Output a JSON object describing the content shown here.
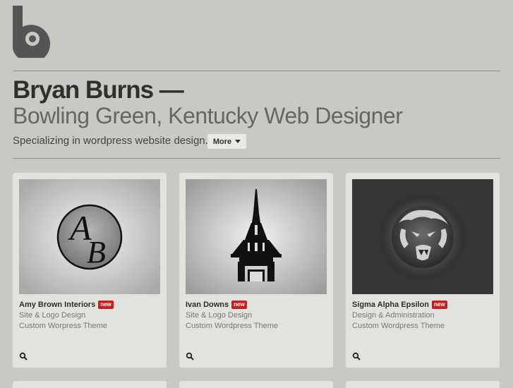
{
  "header": {
    "name": "Bryan Burns —",
    "subtitle": "Bowling Green, Kentucky Web Designer",
    "tagline": "Specializing in wordpress website design.",
    "more_label": "More"
  },
  "portfolio": [
    {
      "title": "Amy Brown Interiors",
      "badge": "new",
      "line1": "Site & Logo Design",
      "line2": "Custom Worpress Theme",
      "thumb_icon": "ab-monogram-logo"
    },
    {
      "title": "Ivan Downs",
      "badge": "new",
      "line1": "Site & Logo Design",
      "line2": "Custom Wordpress Theme",
      "thumb_icon": "tower-spire-logo"
    },
    {
      "title": "Sigma Alpha Epsilon",
      "badge": "new",
      "line1": "Design & Administration",
      "line2": "Custom Wordpress Theme",
      "thumb_icon": "lion-head-logo"
    }
  ],
  "icons": {
    "logo": "b-logo-icon",
    "zoom": "magnifier-icon",
    "more": "caret-down-icon"
  },
  "colors": {
    "background": "#c9c8c3",
    "card": "#e3e3dd",
    "badge": "#c8201f",
    "logo": "#555555"
  }
}
